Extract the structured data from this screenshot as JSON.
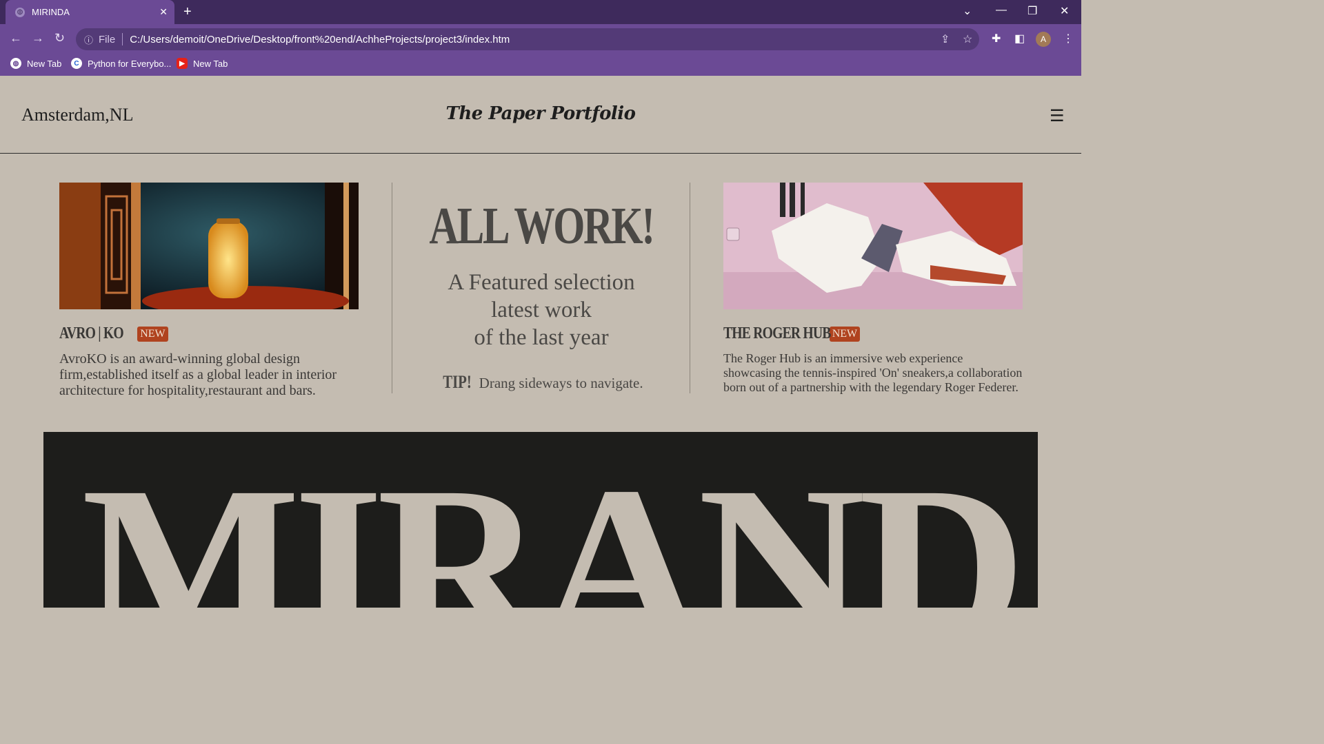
{
  "browser": {
    "tab_title": "MIRINDA",
    "omnibox_label": "File",
    "url": "C:/Users/demoit/OneDrive/Desktop/front%20end/AchheProjects/project3/index.htm",
    "avatar_letter": "A",
    "bookmarks": [
      {
        "label": "New Tab",
        "icon": "globe-icon"
      },
      {
        "label": "Python for Everybo...",
        "icon": "coursera-icon"
      },
      {
        "label": "New Tab",
        "icon": "youtube-icon"
      }
    ]
  },
  "site": {
    "location": "Amsterdam,NL",
    "brand": "The Paper Portfolio",
    "menu_icon": "hamburger-icon"
  },
  "cards": [
    {
      "title": "AVRO | KO",
      "badge": "NEW",
      "description": "AvroKO is an award-winning global design firm,established itself as a global leader in interior architecture for hospitality,restaurant and bars."
    },
    {
      "title": "THE ROGER HUB",
      "badge": "NEW",
      "description": "The Roger Hub is an immersive web experience showcasing the tennis-inspired 'On' sneakers,a collaboration born out of a partnership with the legendary Roger Federer."
    }
  ],
  "center": {
    "heading": "ALL WORK!",
    "line1": "A Featured selection",
    "line2": "latest work",
    "line3": "of the last year",
    "tip_label": "TIP!",
    "tip_text": "Drang sideways to navigate."
  },
  "banner": {
    "word": "MIRANDA"
  },
  "colors": {
    "page_bg": "#c4bcb1",
    "badge": "#b0431f",
    "banner_bg": "#1d1d1b",
    "chrome": "#6b4a95"
  }
}
